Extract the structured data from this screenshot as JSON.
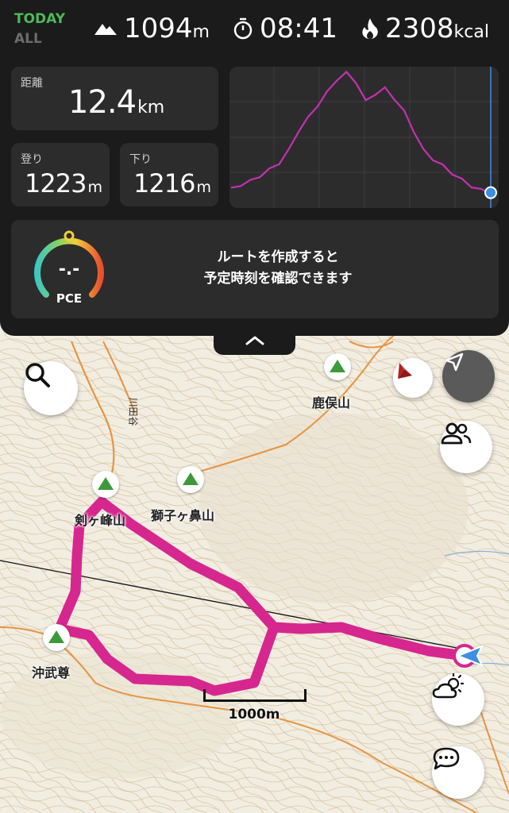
{
  "header": {
    "period_active": "TODAY",
    "period_inactive": "ALL",
    "elevation": {
      "icon": "mountain-icon",
      "value": "1094",
      "unit": "m"
    },
    "elapsed": {
      "icon": "stopwatch-icon",
      "value": "08:41"
    },
    "calories": {
      "icon": "flame-icon",
      "value": "2308",
      "unit": "kcal"
    }
  },
  "stats": {
    "distance": {
      "label": "距離",
      "value": "12.4",
      "unit": "km"
    },
    "ascent": {
      "label": "登り",
      "value": "1223",
      "unit": "m"
    },
    "descent": {
      "label": "下り",
      "value": "1216",
      "unit": "m"
    }
  },
  "elevation_profile": {
    "line_color": "#c431b0",
    "marker_color": "#3d8fe0",
    "points": [
      0.1,
      0.13,
      0.16,
      0.2,
      0.25,
      0.3,
      0.4,
      0.55,
      0.65,
      0.75,
      0.85,
      0.95,
      1.0,
      0.93,
      0.78,
      0.84,
      0.88,
      0.8,
      0.7,
      0.55,
      0.4,
      0.33,
      0.28,
      0.22,
      0.17,
      0.12,
      0.09,
      0.07
    ]
  },
  "pce": {
    "gauge_label": "PCE",
    "gauge_value": "-.-",
    "message_line1": "ルートを作成すると",
    "message_line2": "予定時刻を確認できます"
  },
  "map": {
    "route_color": "#d6278f",
    "peaks": [
      {
        "name": "鹿俣山"
      },
      {
        "name": "剣ヶ峰山"
      },
      {
        "name": "獅子ヶ鼻山"
      },
      {
        "name": "沖武尊"
      }
    ],
    "road_label": "川田谷",
    "scale_label": "1000m",
    "buttons": {
      "search": "search-icon",
      "compass": "compass-icon",
      "locate": "navigation-arrow-icon",
      "group": "people-icon",
      "weather": "weather-icon",
      "chat": "chat-bubble-icon"
    }
  }
}
